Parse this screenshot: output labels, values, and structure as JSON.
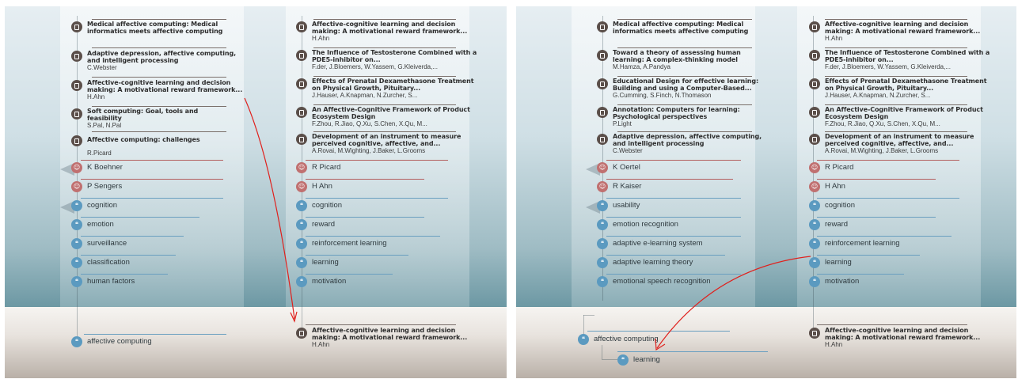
{
  "left": {
    "col_a_docs": [
      {
        "title": "Medical affective computing: Medical informatics meets affective computing",
        "meta": ""
      },
      {
        "title": "Adaptive depression, affective computing, and intelligent processing",
        "meta": "C.Webster"
      },
      {
        "title": "Affective-cognitive learning and decision making: A motivational reward framework...",
        "meta": "H.Ahn"
      },
      {
        "title": "Soft computing: Goal, tools and feasibility",
        "meta": "S.Pal, N.Pal"
      },
      {
        "title": "Affective computing: challenges",
        "meta": "R.Picard"
      }
    ],
    "col_a_people": [
      "K Boehner",
      "P Sengers"
    ],
    "col_a_tags": [
      "cognition",
      "emotion",
      "surveillance",
      "classification",
      "human factors"
    ],
    "col_b_docs": [
      {
        "title": "Affective-cognitive learning and decision making: A motivational reward framework...",
        "meta": "H.Ahn"
      },
      {
        "title": "The Influence of Testosterone Combined with a PDE5-inhibitor on...",
        "meta": "F.der, J.Bloemers, W.Yassem, G.Kleiverda,..."
      },
      {
        "title": "Effects of Prenatal Dexamethasone Treatment on Physical Growth, Pituitary...",
        "meta": "J.Hauser, A.Knapman, N.Zurcher, S..."
      },
      {
        "title": "An Affective-Cognitive Framework of Product Ecosystem Design",
        "meta": "F.Zhou, R.Jiao, Q.Xu, S.Chen, X.Qu, M..."
      },
      {
        "title": "Development of an instrument to measure perceived cognitive, affective, and...",
        "meta": "A.Rovai, M.Wighting, J.Baker, L.Grooms"
      }
    ],
    "col_b_people": [
      "R Picard",
      "H Ahn"
    ],
    "col_b_tags": [
      "cognition",
      "reward",
      "reinforcement learning",
      "learning",
      "motivation"
    ],
    "ground_tag": "affective computing",
    "ground_doc": {
      "title": "Affective-cognitive learning and decision making: A motivational reward framework...",
      "meta": "H.Ahn"
    }
  },
  "right": {
    "col_a_docs": [
      {
        "title": "Medical affective computing: Medical informatics meets affective computing",
        "meta": ""
      },
      {
        "title": "Toward a theory of assessing human learning: A complex-thinking model",
        "meta": "M.Hamza, A.Pandya"
      },
      {
        "title": "Educational Design for effective learning: Building and using a Computer-Based...",
        "meta": "G.Cumming, S.Finch, N.Thomason"
      },
      {
        "title": "Annotation: Computers for learning: Psychological perspectives",
        "meta": "P.Light"
      },
      {
        "title": "Adaptive depression, affective computing, and intelligent processing",
        "meta": "C.Webster"
      }
    ],
    "col_a_people": [
      "K Oertel",
      "R Kaiser"
    ],
    "col_a_tags": [
      "usability",
      "emotion recognition",
      "adaptive e-learning system",
      "adaptive learning theory",
      "emotional speech recognition"
    ],
    "col_b_docs": [
      {
        "title": "Affective-cognitive learning and decision making: A motivational reward framework...",
        "meta": "H.Ahn"
      },
      {
        "title": "The Influence of Testosterone Combined with a PDE5-inhibitor on...",
        "meta": "F.der, J.Bloemers, W.Yassem, G.Kleiverda,..."
      },
      {
        "title": "Effects of Prenatal Dexamethasone Treatment on Physical Growth, Pituitary...",
        "meta": "J.Hauser, A.Knapman, N.Zurcher, S..."
      },
      {
        "title": "An Affective-Cognitive Framework of Product Ecosystem Design",
        "meta": "F.Zhou, R.Jiao, Q.Xu, S.Chen, X.Qu, M..."
      },
      {
        "title": "Development of an instrument to measure perceived cognitive, affective, and...",
        "meta": "A.Rovai, M.Wighting, J.Baker, L.Grooms"
      }
    ],
    "col_b_people": [
      "R Picard",
      "H Ahn"
    ],
    "col_b_tags": [
      "cognition",
      "reward",
      "reinforcement learning",
      "learning",
      "motivation"
    ],
    "ground_tag": "affective computing",
    "ground_tag_child": "learning",
    "ground_doc": {
      "title": "Affective-cognitive learning and decision making: A motivational reward framework...",
      "meta": "H.Ahn"
    }
  },
  "colors": {
    "arrow": "#e0201c",
    "tag_icon": "#5b9ac0",
    "person_icon": "#c07070",
    "doc_icon": "#5b4f4a"
  }
}
